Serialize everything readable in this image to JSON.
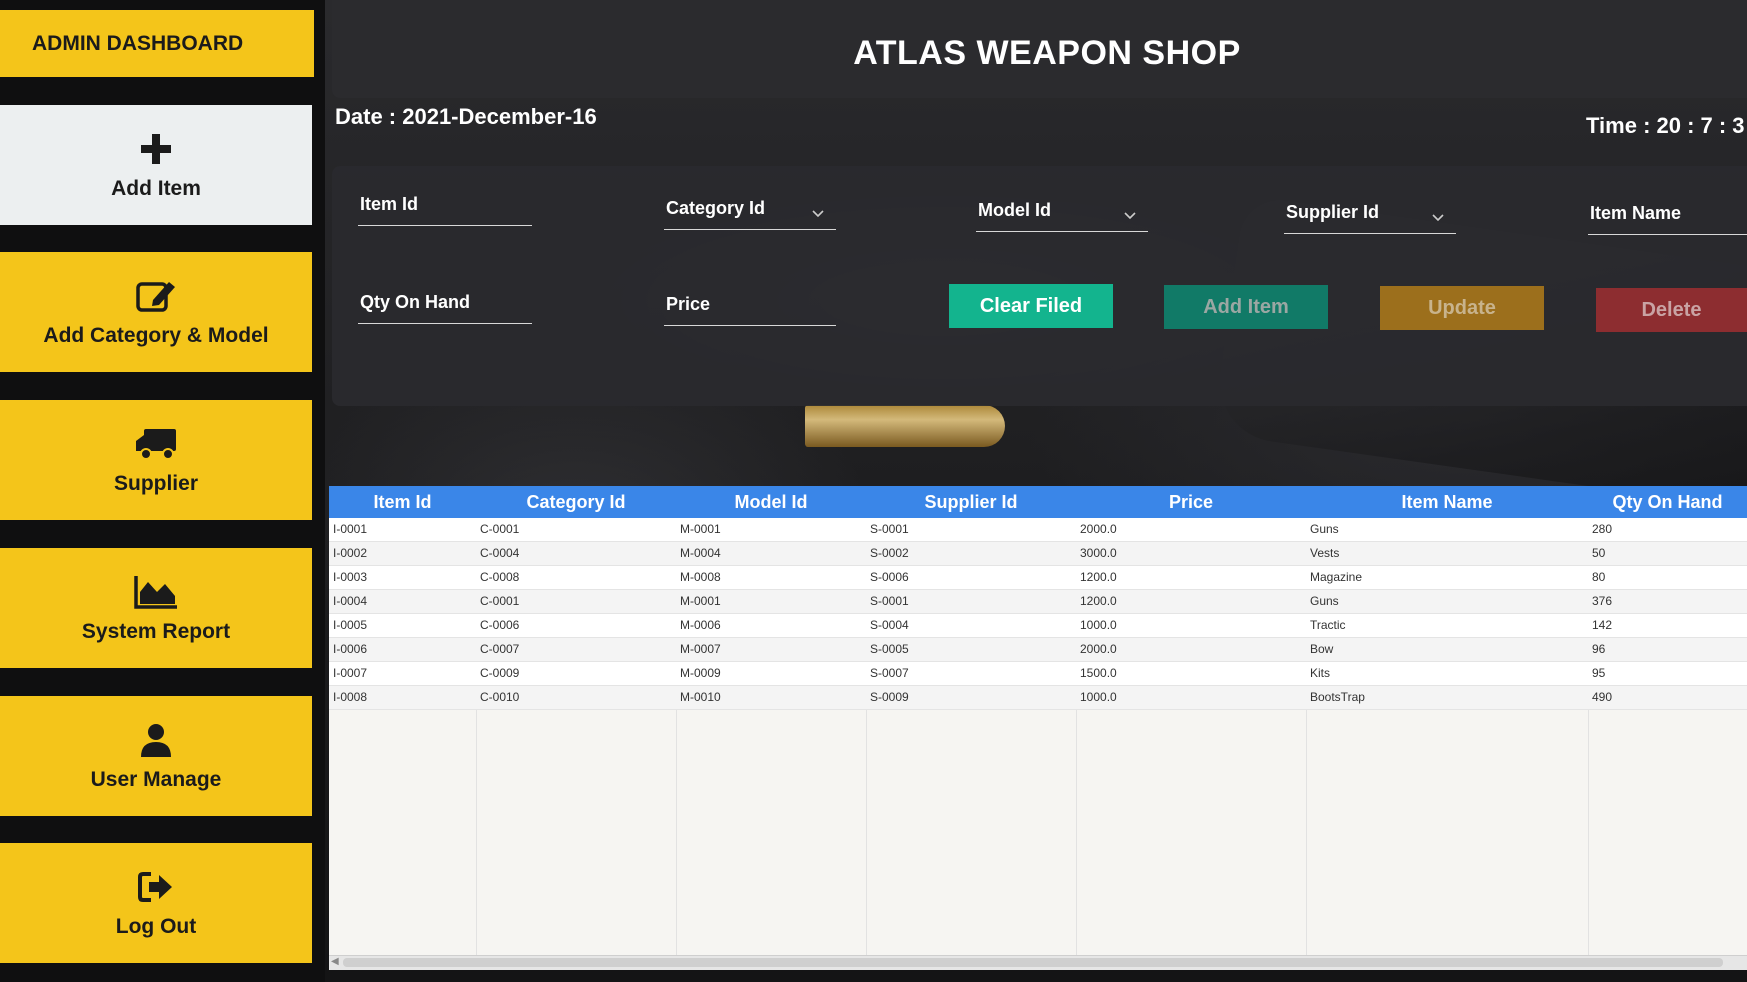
{
  "sidebar": {
    "title": "ADMIN DASHBOARD",
    "items": [
      {
        "label": "Add Item",
        "icon": "plus-icon"
      },
      {
        "label": "Add Category & Model",
        "icon": "edit-icon"
      },
      {
        "label": "Supplier",
        "icon": "truck-icon"
      },
      {
        "label": "System Report",
        "icon": "chart-area-icon"
      },
      {
        "label": "User Manage",
        "icon": "user-icon"
      },
      {
        "label": "Log Out",
        "icon": "logout-icon"
      }
    ]
  },
  "header": {
    "title": "ATLAS WEAPON SHOP",
    "date": "Date : 2021-December-16",
    "time": "Time :   20 : 7 : 3"
  },
  "form": {
    "item_id": "Item Id",
    "category_id": "Category Id",
    "model_id": "Model Id",
    "supplier_id": "Supplier Id",
    "item_name": "Item Name",
    "qty_on_hand": "Qty On Hand",
    "price": "Price",
    "buttons": {
      "clear": "Clear Filed",
      "add": "Add Item",
      "update": "Update",
      "delete": "Delete"
    }
  },
  "colors": {
    "sidebar_yellow": "#f4c51a",
    "clear_btn": "#13b48e",
    "add_btn": "#117a67",
    "update_btn": "#9c6f1c",
    "delete_btn": "#8d2d30",
    "table_header": "#3a86e8"
  },
  "table": {
    "columns": [
      "Item Id",
      "Category Id",
      "Model Id",
      "Supplier Id",
      "Price",
      "Item Name",
      "Qty On Hand"
    ],
    "rows": [
      [
        "I-0001",
        "C-0001",
        "M-0001",
        "S-0001",
        "2000.0",
        "Guns",
        "280"
      ],
      [
        "I-0002",
        "C-0004",
        "M-0004",
        "S-0002",
        "3000.0",
        "Vests",
        "50"
      ],
      [
        "I-0003",
        "C-0008",
        "M-0008",
        "S-0006",
        "1200.0",
        "Magazine",
        "80"
      ],
      [
        "I-0004",
        "C-0001",
        "M-0001",
        "S-0001",
        "1200.0",
        "Guns",
        "376"
      ],
      [
        "I-0005",
        "C-0006",
        "M-0006",
        "S-0004",
        "1000.0",
        "Tractic",
        "142"
      ],
      [
        "I-0006",
        "C-0007",
        "M-0007",
        "S-0005",
        "2000.0",
        "Bow",
        "96"
      ],
      [
        "I-0007",
        "C-0009",
        "M-0009",
        "S-0007",
        "1500.0",
        "Kits",
        "95"
      ],
      [
        "I-0008",
        "C-0010",
        "M-0010",
        "S-0009",
        "1000.0",
        "BootsTrap",
        "490"
      ]
    ]
  }
}
